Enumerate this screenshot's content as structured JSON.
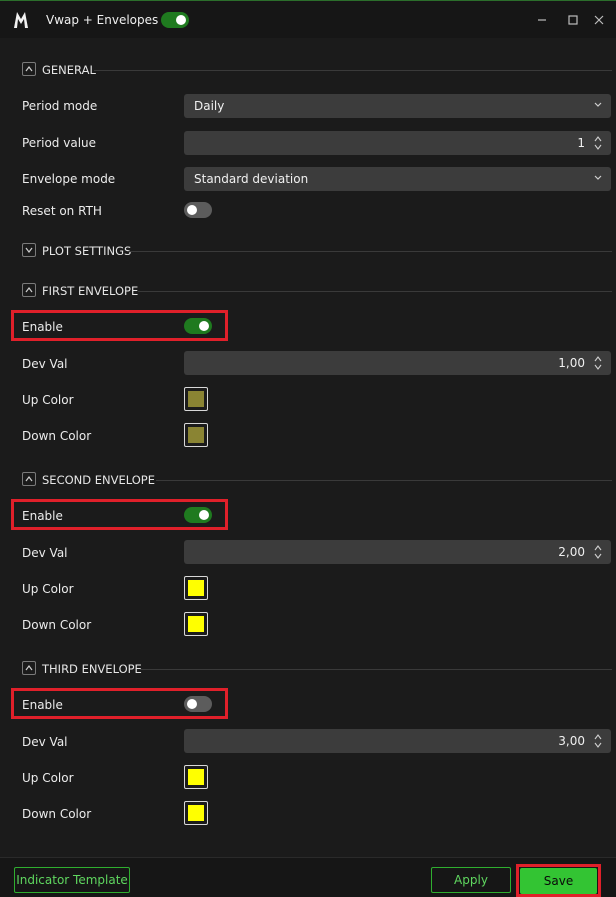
{
  "window": {
    "title": "Vwap + Envelopes",
    "indicator_enabled": true,
    "controls": {
      "minimize": "—",
      "maximize": "☐",
      "close": "✕"
    }
  },
  "general": {
    "header": "GENERAL",
    "period_mode": {
      "label": "Period mode",
      "value": "Daily"
    },
    "period_value": {
      "label": "Period value",
      "value": "1"
    },
    "envelope_mode": {
      "label": "Envelope mode",
      "value": "Standard deviation"
    },
    "reset_on_rth": {
      "label": "Reset on RTH",
      "enabled": false
    }
  },
  "plot_settings": {
    "header": "PLOT SETTINGS"
  },
  "envelopes": [
    {
      "header": "FIRST ENVELOPE",
      "enable": {
        "label": "Enable",
        "enabled": true
      },
      "dev_val": {
        "label": "Dev Val",
        "value": "1,00"
      },
      "up_color": {
        "label": "Up Color",
        "color": "#8a8433"
      },
      "down_color": {
        "label": "Down Color",
        "color": "#8a8433"
      }
    },
    {
      "header": "SECOND ENVELOPE",
      "enable": {
        "label": "Enable",
        "enabled": true
      },
      "dev_val": {
        "label": "Dev Val",
        "value": "2,00"
      },
      "up_color": {
        "label": "Up Color",
        "color": "#ffff00"
      },
      "down_color": {
        "label": "Down Color",
        "color": "#ffff00"
      }
    },
    {
      "header": "THIRD ENVELOPE",
      "enable": {
        "label": "Enable",
        "enabled": false
      },
      "dev_val": {
        "label": "Dev Val",
        "value": "3,00"
      },
      "up_color": {
        "label": "Up Color",
        "color": "#ffff00"
      },
      "down_color": {
        "label": "Down Color",
        "color": "#ffff00"
      }
    }
  ],
  "footer": {
    "template_label": "Indicator Template",
    "apply_label": "Apply",
    "save_label": "Save"
  },
  "colors": {
    "accent_green": "#33c433",
    "toggle_on": "#1f7a1f",
    "highlight_red": "#e0202a"
  }
}
